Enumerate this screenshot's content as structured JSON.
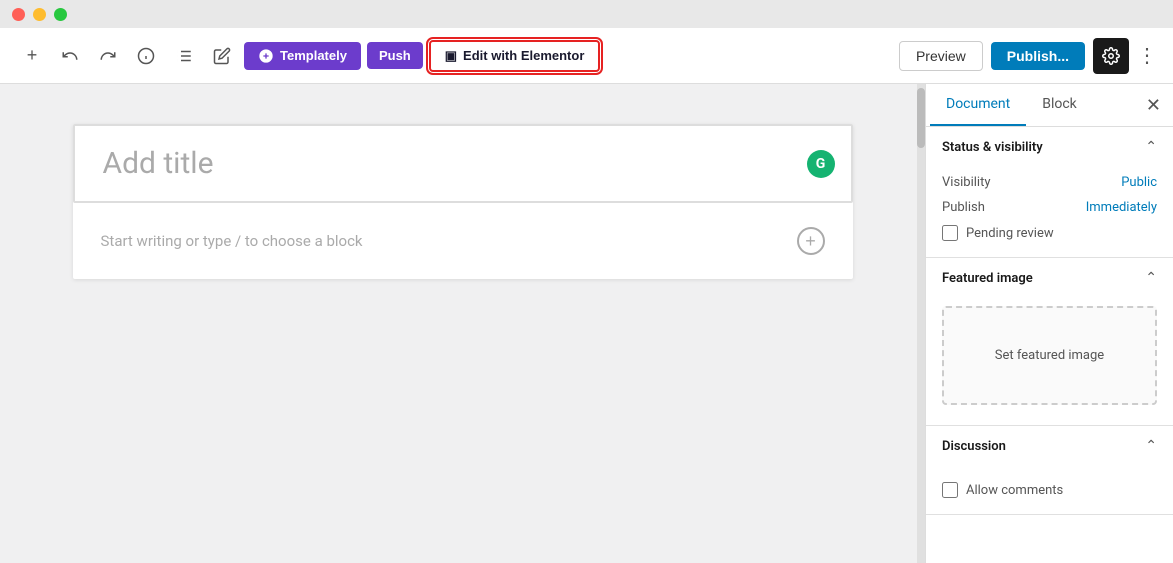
{
  "titleBar": {
    "trafficLights": [
      "red",
      "yellow",
      "green"
    ]
  },
  "toolbar": {
    "undo_icon": "↩",
    "redo_icon": "↪",
    "info_icon": "ℹ",
    "list_icon": "≡",
    "edit_icon": "✏",
    "templately_label": "Templately",
    "push_label": "Push",
    "elementor_label": "Edit with Elementor",
    "elementor_icon": "▣",
    "preview_label": "Preview",
    "publish_label": "Publish...",
    "settings_icon": "⚙",
    "more_icon": "⋮"
  },
  "editor": {
    "title_placeholder": "Add title",
    "body_placeholder": "Start writing or type / to choose a block",
    "grammarly_letter": "G",
    "add_block_icon": "+"
  },
  "sidebar": {
    "tab_document": "Document",
    "tab_block": "Block",
    "close_icon": "✕",
    "sections": [
      {
        "id": "status",
        "title": "Status & visibility",
        "expanded": true,
        "fields": [
          {
            "label": "Visibility",
            "value": "Public"
          },
          {
            "label": "Publish",
            "value": "Immediately"
          }
        ],
        "checkbox": {
          "label": "Pending review",
          "checked": false
        }
      },
      {
        "id": "featured-image",
        "title": "Featured image",
        "expanded": true,
        "set_label": "Set featured image"
      },
      {
        "id": "discussion",
        "title": "Discussion",
        "expanded": true,
        "checkbox": {
          "label": "Allow comments",
          "checked": false
        }
      }
    ]
  }
}
